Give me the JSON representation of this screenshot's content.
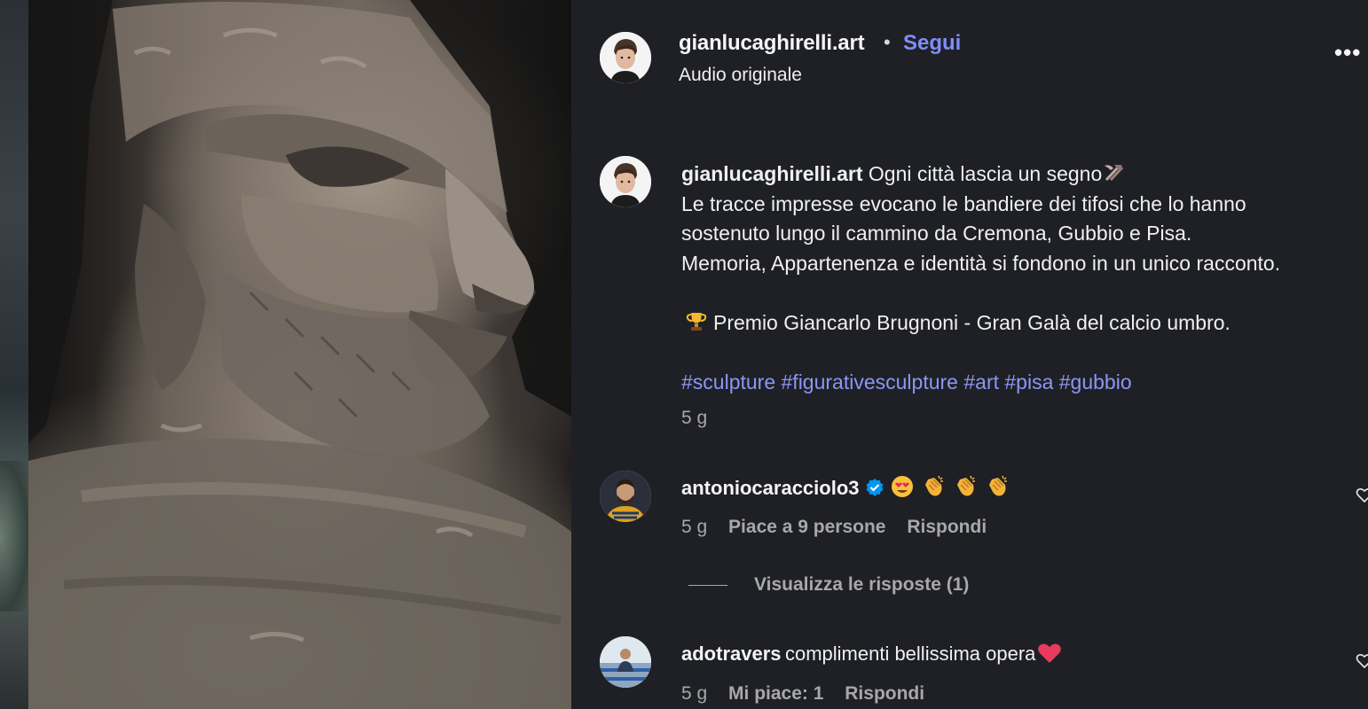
{
  "post": {
    "username": "gianlucaghirelli.art",
    "follow_label": "Segui",
    "dot": "•",
    "audio_label": "Audio originale",
    "more_label": "•••"
  },
  "caption": {
    "username": "gianlucaghirelli.art",
    "line1": "Ogni città lascia un segno",
    "line2": "Le tracce impresse evocano le bandiere dei tifosi che lo hanno",
    "line3": "sostenuto lungo il cammino da Cremona, Gubbio e Pisa.",
    "line4": "Memoria, Appartenenza e identità si fondono in un unico racconto.",
    "award": "Premio Giancarlo Brugnoni - Gran Galà del calcio umbro.",
    "hashtags": [
      "#sculpture",
      "#figurativesculpture",
      "#art",
      "#pisa",
      "#gubbio"
    ],
    "time": "5 g"
  },
  "comments": [
    {
      "username": "antoniocaracciolo3",
      "text": "",
      "time": "5 g",
      "likes": "Piace a 9 persone",
      "reply": "Rispondi",
      "view_replies": "Visualizza le risposte (1)"
    },
    {
      "username": "adotravers",
      "text": "complimenti bellissima opera",
      "time": "5 g",
      "likes": "Mi piace: 1",
      "reply": "Rispondi"
    }
  ],
  "colors": {
    "background": "#1f2025",
    "link": "#7f8df8",
    "hashtag": "#8b96f5",
    "muted": "#a8a8a8",
    "verified": "#0095f6"
  },
  "icons": [
    "hammer-pick-icon",
    "trophy-icon",
    "verified-badge-icon",
    "heart-eyes-emoji-icon",
    "clapping-hands-icon",
    "red-heart-icon",
    "heart-outline-icon",
    "more-options-icon"
  ]
}
